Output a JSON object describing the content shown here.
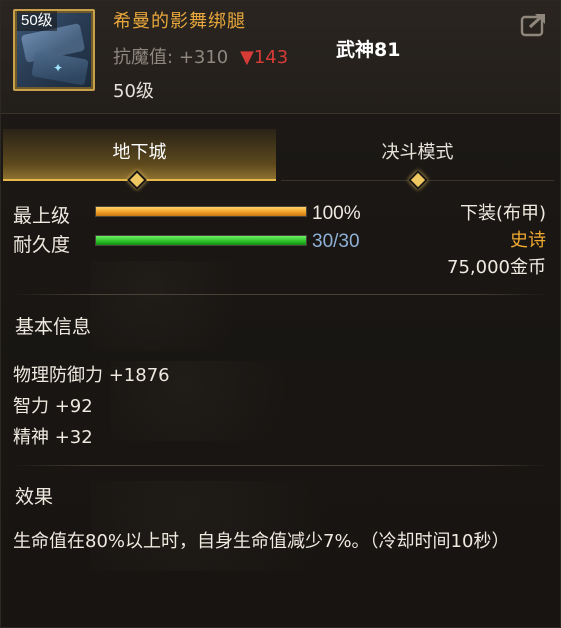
{
  "header": {
    "level_badge": "50级",
    "item_name": "希曼的影舞绑腿",
    "stat_label": "抗魔值:",
    "stat_value": "+310",
    "stat_diff": "▼143",
    "title_rank": "武神81",
    "required_level": "50级"
  },
  "tabs": [
    {
      "label": "地下城",
      "active": true
    },
    {
      "label": "决斗模式",
      "active": false
    }
  ],
  "bars": {
    "top_level": {
      "label": "最上级",
      "value": "100%",
      "fill": 1.0
    },
    "durability": {
      "label": "耐久度",
      "value": "30/30",
      "fill": 1.0
    }
  },
  "item_info": {
    "slot": "下装(布甲)",
    "rarity": "史诗",
    "price": "75,000金币"
  },
  "basic_info": {
    "title": "基本信息",
    "stats": [
      "物理防御力 +1876",
      "智力 +92",
      "精神 +32"
    ]
  },
  "effect": {
    "title": "效果",
    "text": "生命值在80%以上时，自身生命值减少7%。（冷却时间10秒）"
  },
  "colors": {
    "item_name": "#e8a73c",
    "rarity": "#f0a92f",
    "stat_down": "#d63b37",
    "durability_value": "#8fb0d6",
    "accent": "#e8b84a"
  },
  "icons": {
    "share": "share-icon",
    "item": "leggings-icon"
  }
}
